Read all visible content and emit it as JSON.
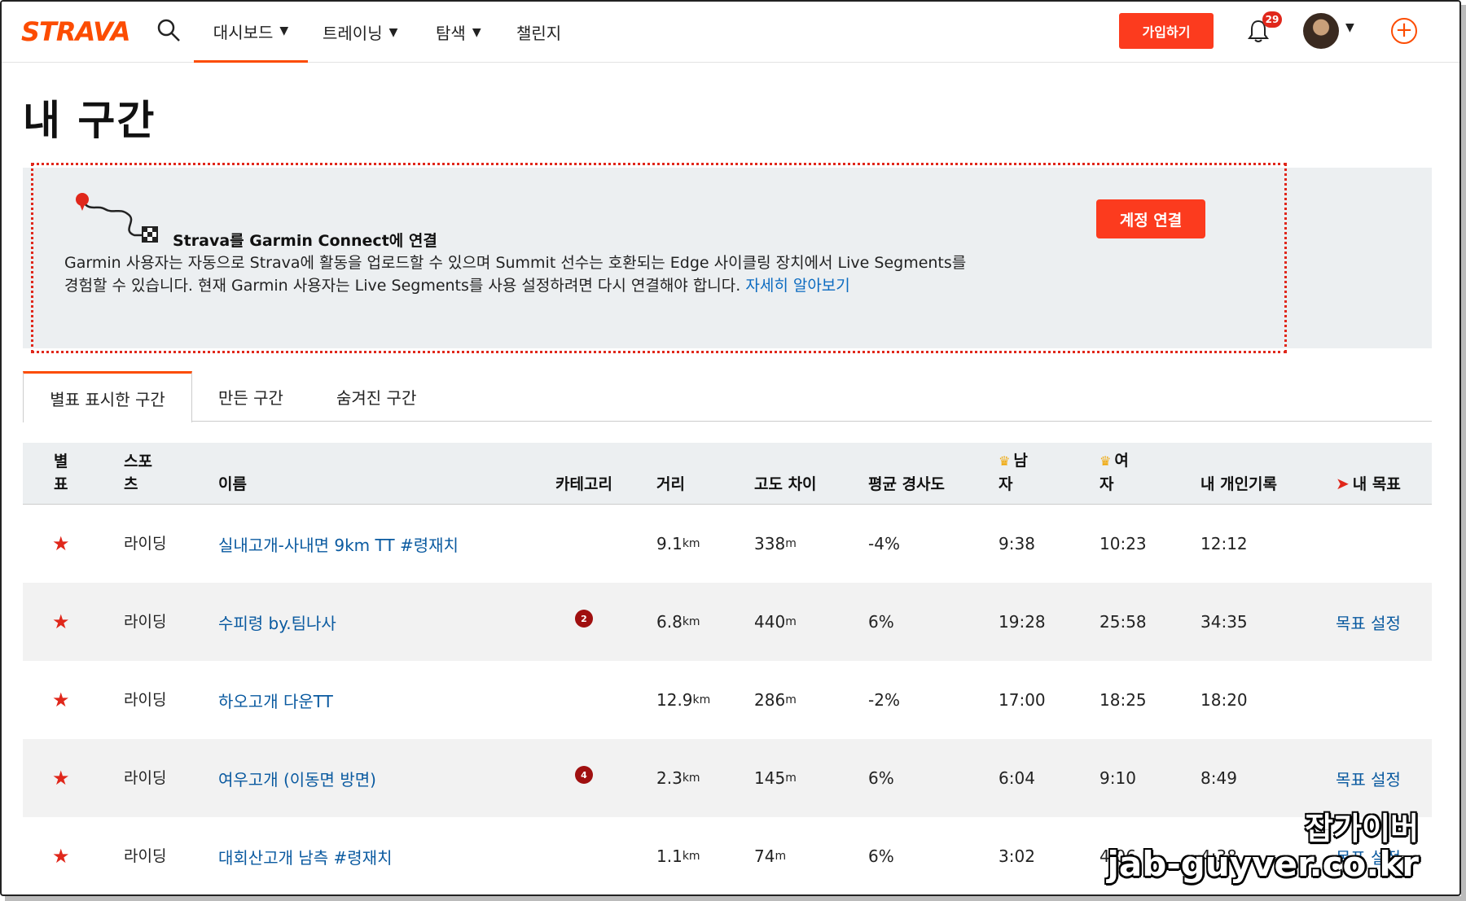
{
  "nav": {
    "logo": "STRAVA",
    "items": [
      {
        "label": "대시보드",
        "has_dropdown": true,
        "active": true
      },
      {
        "label": "트레이닝",
        "has_dropdown": true,
        "active": false
      },
      {
        "label": "탐색",
        "has_dropdown": true,
        "active": false
      },
      {
        "label": "챌린지",
        "has_dropdown": false,
        "active": false
      }
    ],
    "signup_label": "가입하기",
    "notification_count": "29",
    "icons": {
      "search": "search-icon",
      "bell": "bell-icon",
      "add": "plus-circle-icon",
      "chevron": "chevron-down-icon"
    }
  },
  "page_title": "내 구간",
  "banner": {
    "title": "Strava를 Garmin Connect에 연결",
    "body": "Garmin 사용자는 자동으로 Strava에 활동을 업로드할 수 있으며 Summit 선수는 호환되는 Edge 사이클링 장치에서 Live Segments를 경험할 수 있습니다. 현재 Garmin 사용자는 Live Segments를 사용 설정하려면 다시 연결해야 합니다.",
    "link_label": "자세히 알아보기",
    "button_label": "계정 연결"
  },
  "tabs": [
    {
      "label": "별표 표시한 구간",
      "active": true
    },
    {
      "label": "만든 구간",
      "active": false
    },
    {
      "label": "숨겨진 구간",
      "active": false
    }
  ],
  "table": {
    "headers": {
      "star": "별표",
      "sport": "스포츠",
      "name": "이름",
      "category": "카테고리",
      "distance": "거리",
      "elev": "고도 차이",
      "grade": "평균 경사도",
      "kom": "남자",
      "qom": "여자",
      "pr": "내 개인기록",
      "goal": "내 목표"
    },
    "rows": [
      {
        "sport": "라이딩",
        "name": "실내고개-사내면 9km TT #령재치",
        "category": "",
        "distance": "9.1",
        "elev": "338",
        "grade": "-4%",
        "kom": "9:38",
        "qom": "10:23",
        "pr": "12:12",
        "goal": ""
      },
      {
        "sport": "라이딩",
        "name": "수피령 by.팀나사",
        "category": "2",
        "distance": "6.8",
        "elev": "440",
        "grade": "6%",
        "kom": "19:28",
        "qom": "25:58",
        "pr": "34:35",
        "goal": "목표 설정"
      },
      {
        "sport": "라이딩",
        "name": "하오고개 다운TT",
        "category": "",
        "distance": "12.9",
        "elev": "286",
        "grade": "-2%",
        "kom": "17:00",
        "qom": "18:25",
        "pr": "18:20",
        "goal": ""
      },
      {
        "sport": "라이딩",
        "name": "여우고개 (이동면 방면)",
        "category": "4",
        "distance": "2.3",
        "elev": "145",
        "grade": "6%",
        "kom": "6:04",
        "qom": "9:10",
        "pr": "8:49",
        "goal": "목표 설정"
      },
      {
        "sport": "라이딩",
        "name": "대회산고개 남측 #령재치",
        "category": "",
        "distance": "1.1",
        "elev": "74",
        "grade": "6%",
        "kom": "3:02",
        "qom": "4:06",
        "pr": "4:38",
        "goal": "목표 설정"
      }
    ],
    "units": {
      "distance": "km",
      "elev": "m"
    }
  },
  "watermark": {
    "line1": "잡가이버",
    "line2": "jab-guyver.co.kr"
  },
  "colors": {
    "brand": "#fc4c02",
    "button": "#fc3b1e",
    "link": "#0a5aa0",
    "star": "#e0271b"
  }
}
